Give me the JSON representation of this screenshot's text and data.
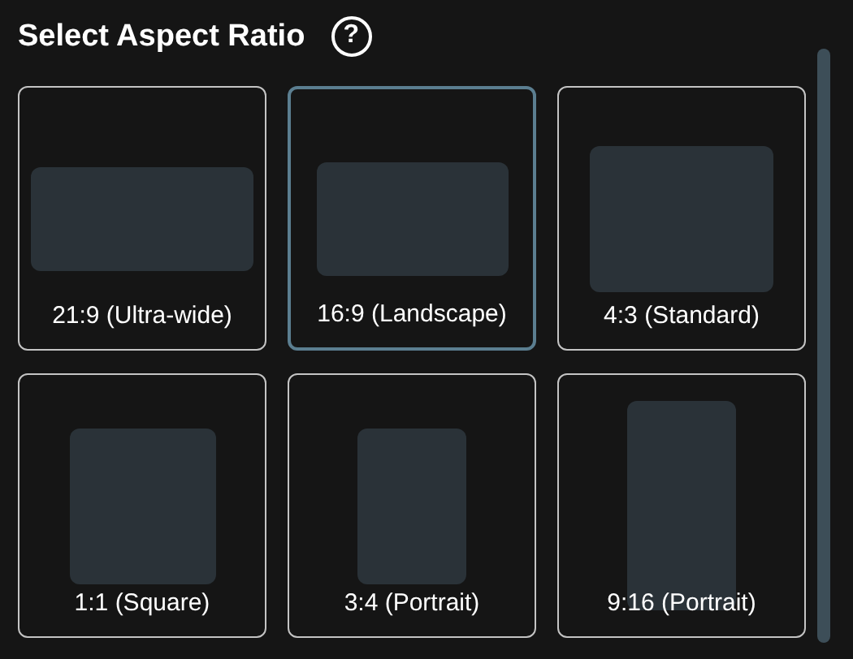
{
  "title": "Select Aspect Ratio",
  "help_icon": "?",
  "options": [
    {
      "label": "21:9 (Ultra-wide)",
      "selected": false
    },
    {
      "label": "16:9 (Landscape)",
      "selected": true
    },
    {
      "label": "4:3 (Standard)",
      "selected": false
    },
    {
      "label": "1:1 (Square)",
      "selected": false
    },
    {
      "label": "3:4 (Portrait)",
      "selected": false
    },
    {
      "label": "9:16 (Portrait)",
      "selected": false
    }
  ]
}
